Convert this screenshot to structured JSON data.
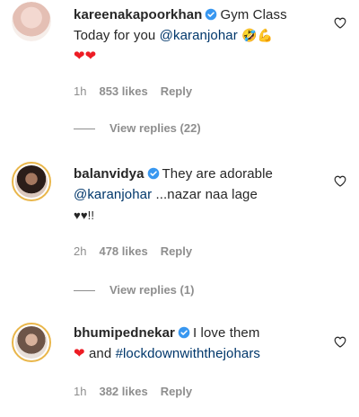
{
  "comments": [
    {
      "username": "kareenakapoorkhan",
      "text_before": "Gym Class",
      "text_line2": "Today for you",
      "mention": "@karanjohar",
      "emojis": "🤣💪",
      "hearts": "❤❤",
      "time": "1h",
      "likes": "853 likes",
      "reply": "Reply",
      "view_replies": "View replies (22)"
    },
    {
      "username": "balanvidya",
      "text_before": "They are adorable",
      "mention": "@karanjohar",
      "text_after": "...nazar naa lage",
      "text_line3": "♥♥!!",
      "time": "2h",
      "likes": "478 likes",
      "reply": "Reply",
      "view_replies": "View replies (1)"
    },
    {
      "username": "bhumipednekar",
      "text_before": "I love them",
      "heart": "❤",
      "text_and": "and",
      "hashtag": "#lockdownwiththejohars",
      "time": "1h",
      "likes": "382 likes",
      "reply": "Reply"
    }
  ],
  "icons": {
    "verified": "verified-badge-icon",
    "like": "heart-outline-icon"
  },
  "colors": {
    "link": "#00376b",
    "verified": "#3897f0",
    "meta": "#8e8e8e",
    "heart": "#ed1c24"
  }
}
